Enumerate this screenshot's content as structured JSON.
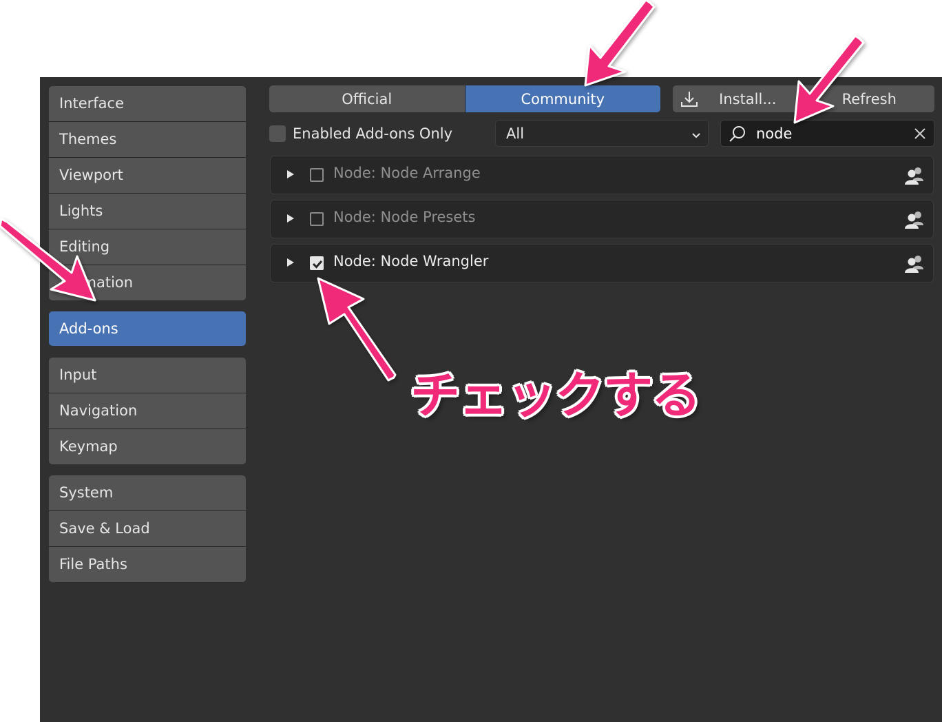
{
  "sidebar": {
    "groups": [
      [
        "Interface",
        "Themes",
        "Viewport",
        "Lights",
        "Editing",
        "Animation"
      ],
      [
        "Add-ons"
      ],
      [
        "Input",
        "Navigation",
        "Keymap"
      ],
      [
        "System",
        "Save & Load",
        "File Paths"
      ]
    ],
    "active": "Add-ons"
  },
  "tabs": {
    "official": "Official",
    "community": "Community",
    "active": "Community"
  },
  "buttons": {
    "install": "Install...",
    "refresh": "Refresh"
  },
  "filter": {
    "enabled_only_label": "Enabled Add-ons Only",
    "enabled_only_checked": false,
    "category": "All"
  },
  "search": {
    "value": "node"
  },
  "addons": [
    {
      "name": "Node: Node Arrange",
      "enabled": false
    },
    {
      "name": "Node: Node Presets",
      "enabled": false
    },
    {
      "name": "Node: Node Wrangler",
      "enabled": true
    }
  ],
  "annotation": {
    "text": "チェックする",
    "color": "#f02a79"
  },
  "colors": {
    "accent": "#4772b3",
    "background": "#303030",
    "annotation": "#f02a79"
  }
}
